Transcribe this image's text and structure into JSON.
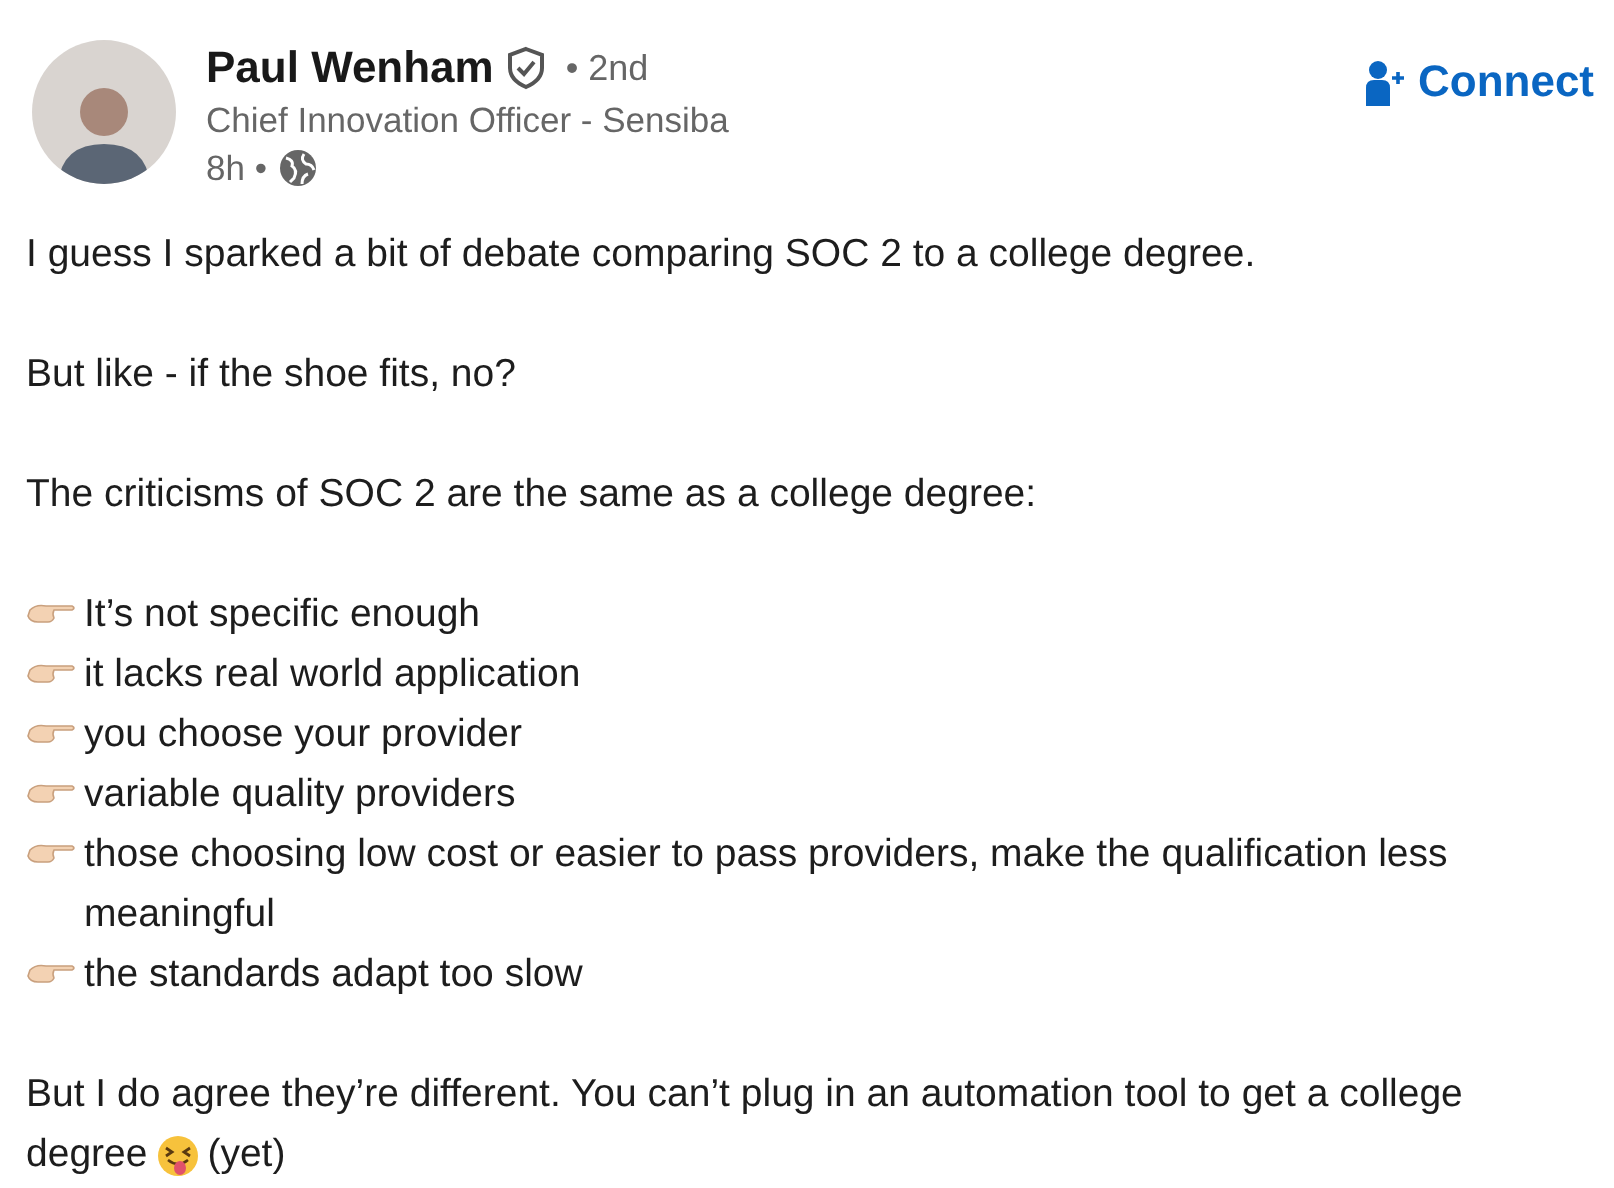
{
  "author": {
    "name": "Paul Wenham",
    "verified": true,
    "degree": "• 2nd",
    "headline": "Chief Innovation Officer - Sensiba",
    "time": "8h •"
  },
  "connect_button": {
    "label": "Connect"
  },
  "body": [
    {
      "kind": "paragraph",
      "text": "I guess I sparked a bit of debate comparing SOC 2 to a college degree."
    },
    {
      "kind": "paragraph",
      "text": "But like - if the shoe fits, no?"
    },
    {
      "kind": "paragraph",
      "text": "The criticisms of SOC 2 are the same as a college degree:"
    },
    {
      "kind": "bullets",
      "items": [
        "It’s not specific enough",
        "it lacks real world application",
        "you choose your provider",
        "variable quality providers",
        "those choosing low cost or easier to pass providers, make the qualification less meaningful",
        "the standards adapt too slow"
      ]
    },
    {
      "kind": "emoji_paragraph",
      "before": "But I do agree they’re different. You can’t plug in an automation tool to get a college degree",
      "after": "(yet)"
    }
  ]
}
